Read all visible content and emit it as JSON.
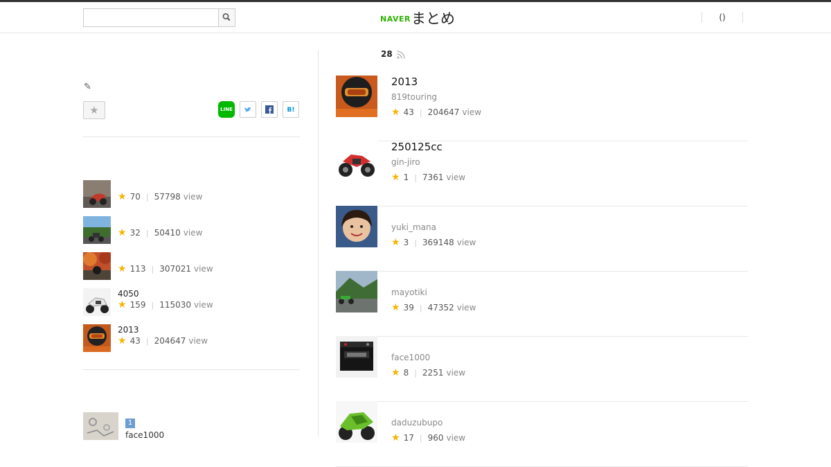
{
  "header": {
    "search_placeholder": "",
    "brand_naver": "NAVER",
    "brand_matome": "まとめ",
    "user_menu": "()"
  },
  "left": {
    "side_items": [
      {
        "title": "",
        "fav": "70",
        "views": "57798",
        "view_label": "view"
      },
      {
        "title": "",
        "fav": "32",
        "views": "50410",
        "view_label": "view"
      },
      {
        "title": "",
        "fav": "113",
        "views": "307021",
        "view_label": "view"
      },
      {
        "title": "4050",
        "fav": "159",
        "views": "115030",
        "view_label": "view"
      },
      {
        "title": "2013",
        "fav": "43",
        "views": "204647",
        "view_label": "view"
      }
    ],
    "ranking": {
      "rank": "1",
      "name": "face1000"
    }
  },
  "main": {
    "count": "28",
    "items": [
      {
        "title": "2013",
        "author": "819touring",
        "fav": "43",
        "views": "204647",
        "view_label": "view"
      },
      {
        "title": "250125cc",
        "author": "gin-jiro",
        "fav": "1",
        "views": "7361",
        "view_label": "view"
      },
      {
        "title": "",
        "author": "yuki_mana",
        "fav": "3",
        "views": "369148",
        "view_label": "view"
      },
      {
        "title": "",
        "author": "mayotiki",
        "fav": "39",
        "views": "47352",
        "view_label": "view"
      },
      {
        "title": "",
        "author": "face1000",
        "fav": "8",
        "views": "2251",
        "view_label": "view"
      },
      {
        "title": "",
        "author": "daduzubupo",
        "fav": "17",
        "views": "960",
        "view_label": "view"
      }
    ]
  },
  "colors": {
    "brand_green": "#2db400",
    "star": "#f5b400",
    "line_green": "#00b900",
    "twitter": "#55acee",
    "facebook": "#3b5998",
    "hatena": "#008fde",
    "rank_badge": "#6e9ecf"
  },
  "icons": [
    "search-icon",
    "pencil-icon",
    "star-icon",
    "line-icon",
    "twitter-icon",
    "facebook-icon",
    "hatena-icon",
    "rss-icon"
  ]
}
